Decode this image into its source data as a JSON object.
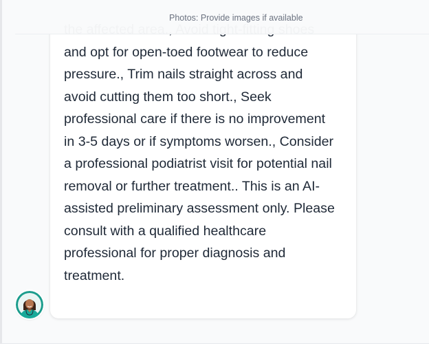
{
  "photos_hint": "Photos: Provide images if available",
  "message": {
    "text": "the affected area., Avoid tight-fitting shoes\nand opt for open-toed footwear to reduce\npressure., Trim nails straight across and\navoid cutting them too short., Seek\nprofessional care if there is no improvement\nin 3-5 days or if symptoms worsen., Consider\na professional podiatrist visit for potential nail\nremoval or further treatment.. This is an AI-\nassisted preliminary assessment only. Please\nconsult with a qualified healthcare\nprofessional for proper diagnosis and\ntreatment."
  },
  "avatar": {
    "icon": "doctor-avatar-icon",
    "ring_color": "#1a9c8c",
    "scrub_color": "#18a999"
  },
  "colors": {
    "background": "#f9fafb",
    "bubble": "#ffffff",
    "text": "#1f2937",
    "hint_text": "#6b7280"
  }
}
